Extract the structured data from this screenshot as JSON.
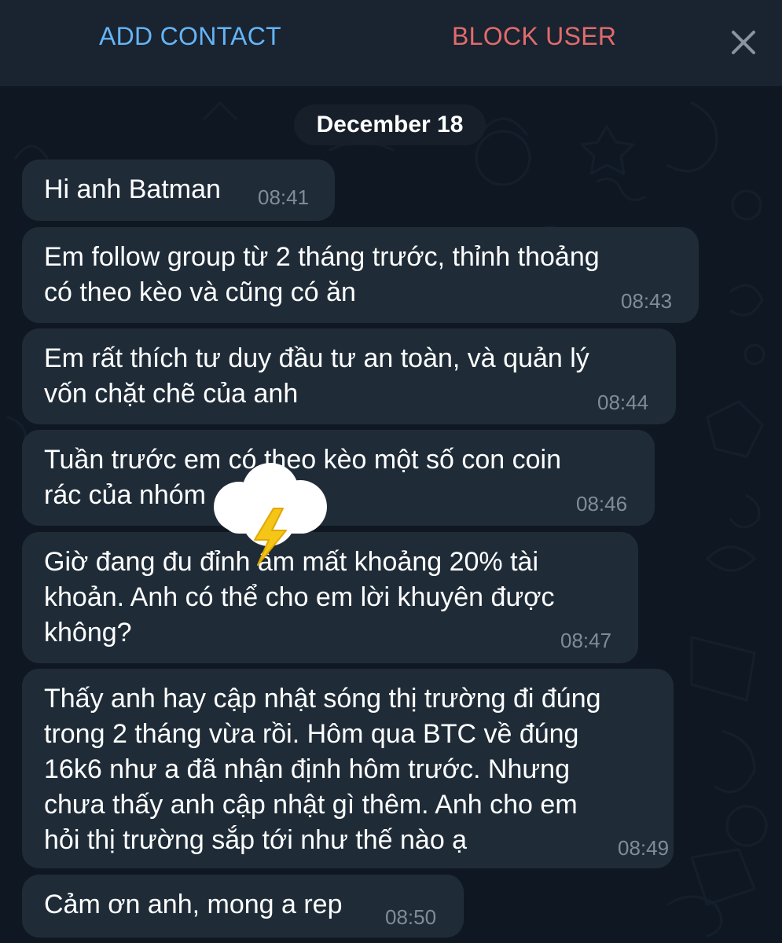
{
  "header": {
    "add_contact": "ADD CONTACT",
    "block_user": "BLOCK USER",
    "close_icon": "close-icon"
  },
  "chat": {
    "date": "December 18",
    "messages": [
      {
        "text": "Hi anh Batman",
        "time": "08:41"
      },
      {
        "text": "Em follow group từ 2 tháng trước, thỉnh thoảng\ncó theo kèo và cũng có ăn",
        "time": "08:43"
      },
      {
        "text": "Em rất thích tư duy đầu tư an toàn, và quản lý\nvốn chặt chẽ của anh",
        "time": "08:44"
      },
      {
        "text": "Tuần trước em có theo kèo một số con coin\nrác của nhóm",
        "time": "08:46"
      },
      {
        "text": "Giờ đang đu đỉnh âm mất khoảng 20% tài\nkhoản. Anh có thể cho em lời khuyên được\nkhông?",
        "time": "08:47"
      },
      {
        "text": "Thấy anh hay cập nhật sóng thị trường đi đúng\ntrong 2 tháng vừa rồi. Hôm qua BTC về đúng\n16k6 như a đã nhận định hôm trước. Nhưng\nchưa thấy anh cập nhật gì thêm. Anh cho em\nhỏi thị trường sắp tới như thế nào ạ",
        "time": "08:49"
      },
      {
        "text": "Cảm ơn anh, mong a rep",
        "time": "08:50"
      }
    ]
  },
  "sticker": {
    "icon": "cloud-lightning-icon"
  },
  "colors": {
    "accent_blue": "#64b5f6",
    "danger_red": "#e26b6b",
    "bubble_bg": "#1f2c38",
    "chat_bg": "#0f1822",
    "time_text": "#7f8c99"
  }
}
